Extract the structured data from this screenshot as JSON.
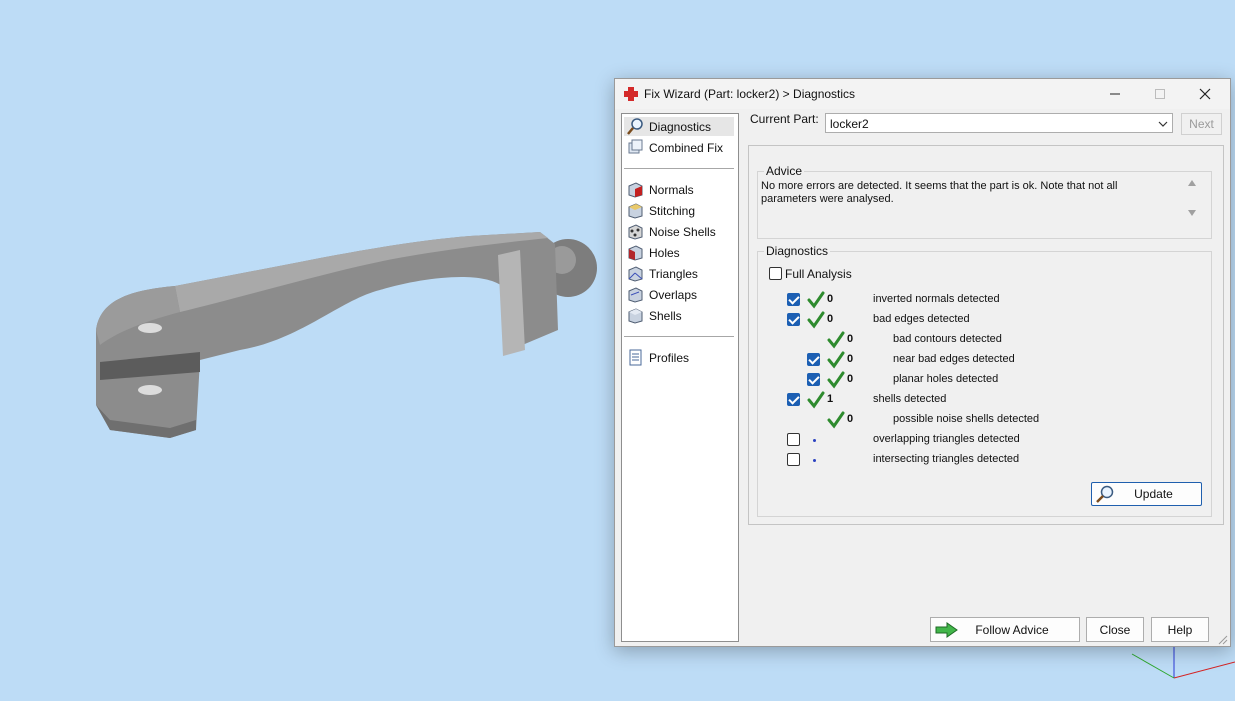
{
  "dialog": {
    "title": "Fix Wizard (Part: locker2) > Diagnostics",
    "controls": [
      "minimize",
      "maximize",
      "close"
    ]
  },
  "sidebar": {
    "items": [
      {
        "label": "Diagnostics",
        "icon": "magnifier-icon",
        "selected": true
      },
      {
        "label": "Combined Fix",
        "icon": "combined-fix-icon",
        "selected": false
      },
      {
        "label": "Normals",
        "icon": "normals-cube-icon",
        "selected": false
      },
      {
        "label": "Stitching",
        "icon": "stitching-cube-icon",
        "selected": false
      },
      {
        "label": "Noise Shells",
        "icon": "noise-shells-icon",
        "selected": false
      },
      {
        "label": "Holes",
        "icon": "holes-cube-icon",
        "selected": false
      },
      {
        "label": "Triangles",
        "icon": "triangles-cube-icon",
        "selected": false
      },
      {
        "label": "Overlaps",
        "icon": "overlaps-cube-icon",
        "selected": false
      },
      {
        "label": "Shells",
        "icon": "shells-cube-icon",
        "selected": false
      },
      {
        "label": "Profiles",
        "icon": "profiles-document-icon",
        "selected": false
      }
    ]
  },
  "current_part": {
    "label": "Current Part:",
    "value": "locker2",
    "next_label": "Next"
  },
  "advice": {
    "title": "Advice",
    "text": "No more errors are detected. It seems that the part is ok. Note that not all parameters were analysed."
  },
  "diagnostics": {
    "title": "Diagnostics",
    "full_analysis_label": "Full Analysis",
    "full_analysis_checked": false,
    "rows": [
      {
        "checkbox": "checked",
        "status": "ok",
        "count": "0",
        "label": "inverted normals detected"
      },
      {
        "checkbox": "checked",
        "status": "ok",
        "count": "0",
        "label": "bad edges detected"
      },
      {
        "checkbox": "none",
        "status": "ok",
        "count": "0",
        "label": "bad contours detected"
      },
      {
        "checkbox": "checked",
        "status": "ok",
        "count": "0",
        "label": "near bad edges detected"
      },
      {
        "checkbox": "checked",
        "status": "ok",
        "count": "0",
        "label": "planar holes detected"
      },
      {
        "checkbox": "checked",
        "status": "ok",
        "count": "1",
        "label": "shells detected"
      },
      {
        "checkbox": "none",
        "status": "ok",
        "count": "0",
        "label": "possible noise shells detected"
      },
      {
        "checkbox": "unchecked",
        "status": "pending",
        "count": "",
        "label": "overlapping triangles detected"
      },
      {
        "checkbox": "unchecked",
        "status": "pending",
        "count": "",
        "label": "intersecting triangles detected"
      }
    ],
    "update_label": "Update"
  },
  "footer": {
    "follow_advice_label": "Follow Advice",
    "close_label": "Close",
    "help_label": "Help"
  },
  "colors": {
    "viewport_background": "#bddcf6",
    "model_gray": "#8c8c8c",
    "check_green": "#2e8b2e",
    "checkbox_blue": "#1c5fb3",
    "title_icon_red": "#d42a2a"
  }
}
